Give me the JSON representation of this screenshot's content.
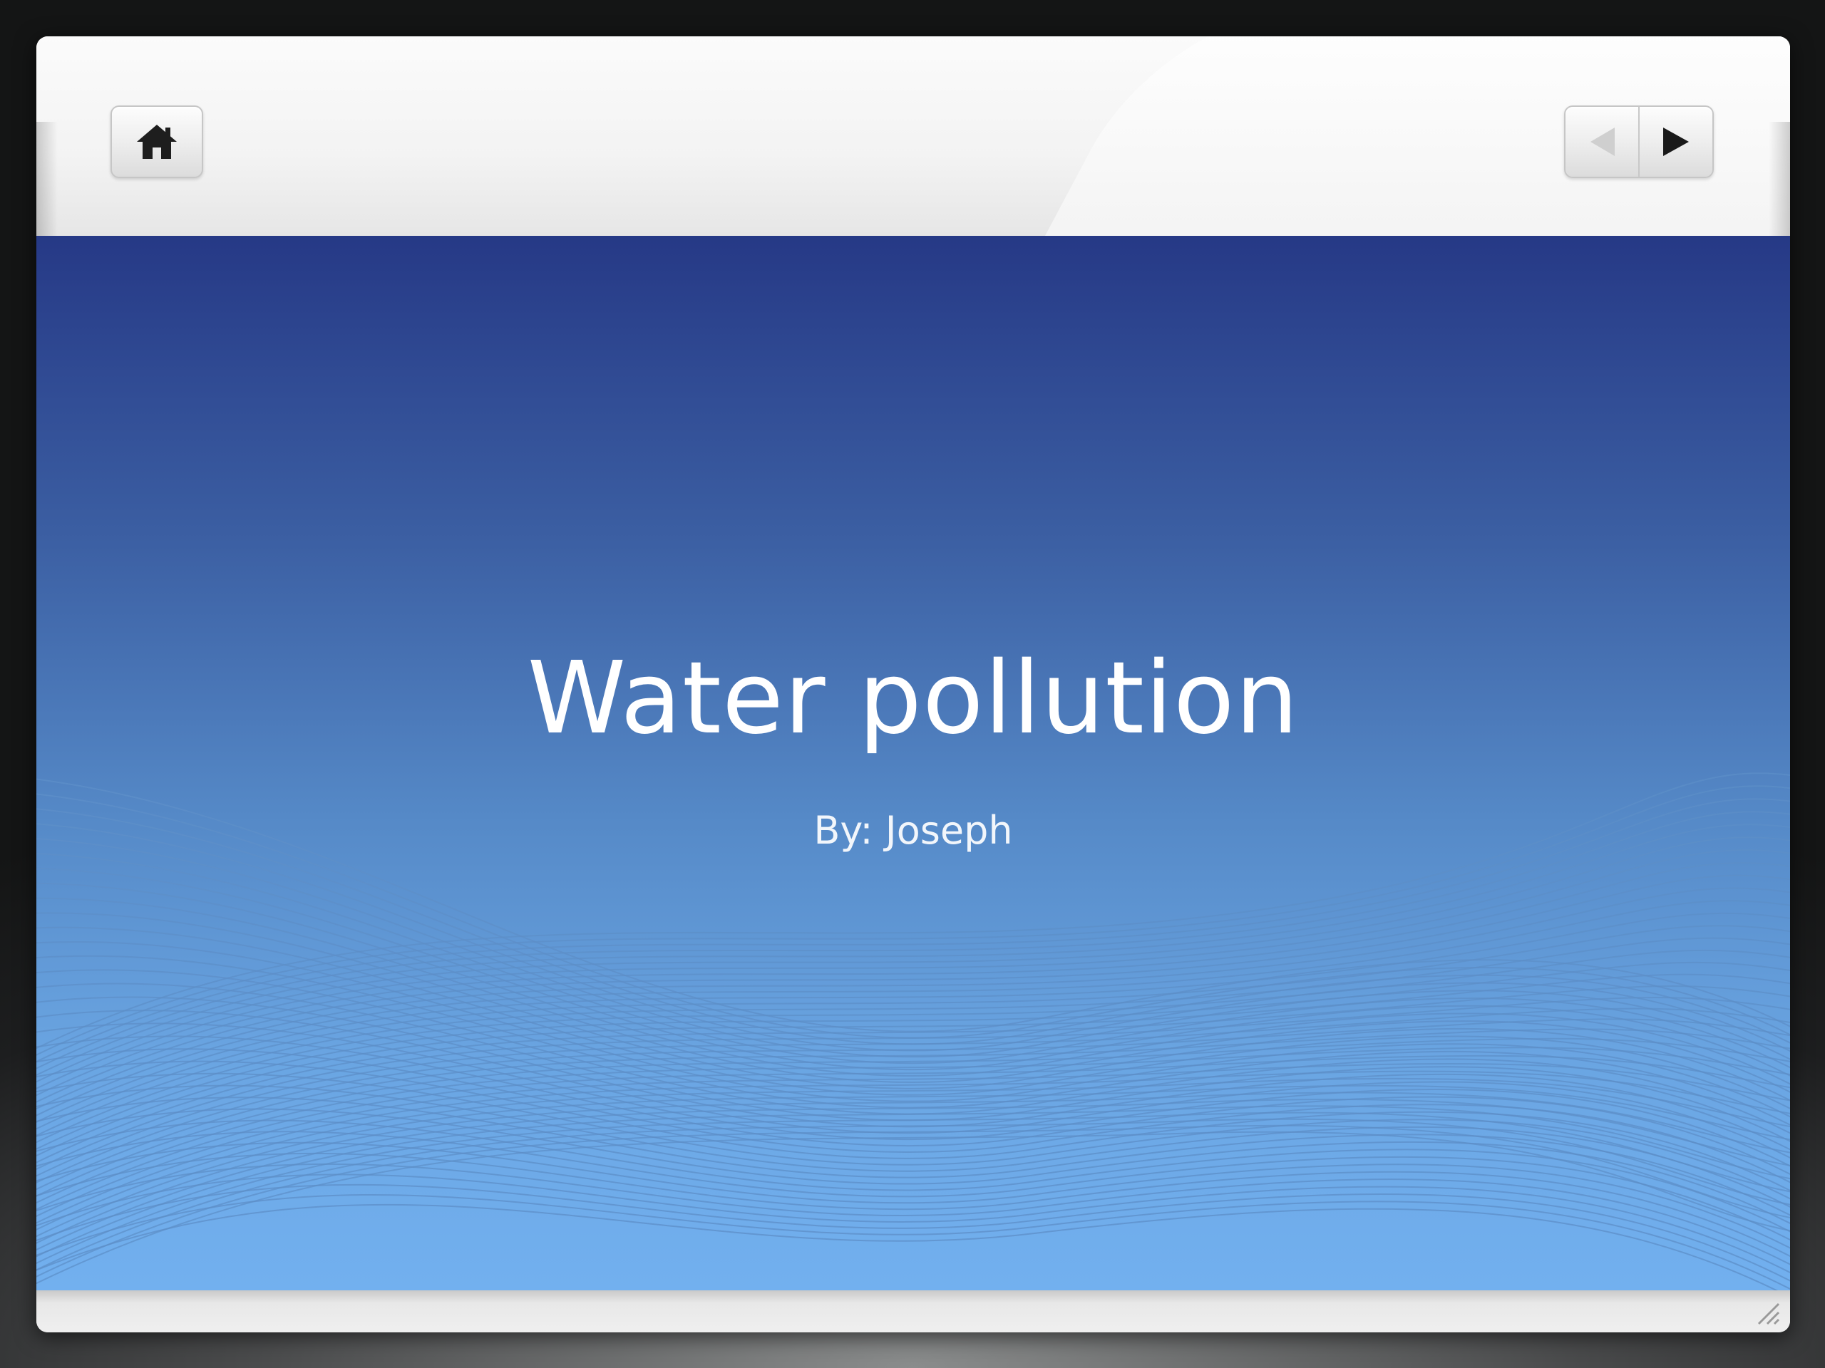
{
  "toolbar": {
    "home_icon": "home-icon",
    "prev_icon": "triangle-left-icon",
    "next_icon": "triangle-right-icon"
  },
  "slide": {
    "title": "Water pollution",
    "subtitle": "By: Joseph"
  },
  "colors": {
    "slide_top": "#263986",
    "slide_bottom": "#72b0ef",
    "wave_lines": "#5d8fc8",
    "frame": "#f4f4f4",
    "text": "#ffffff"
  }
}
